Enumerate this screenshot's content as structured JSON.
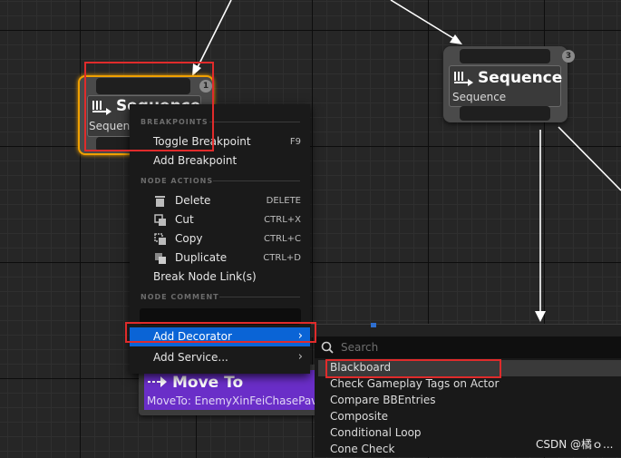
{
  "graph": {
    "node_left": {
      "title": "Sequence",
      "subtitle": "Sequence",
      "badge": "1",
      "icon": "sequence-icon"
    },
    "node_right": {
      "title": "Sequence",
      "subtitle": "Sequence",
      "badge": "3",
      "icon": "sequence-icon"
    },
    "node_moveto": {
      "title": "Move To",
      "subtitle": "MoveTo: EnemyXinFeiChasePav",
      "icon": "move-to-icon"
    }
  },
  "context_menu": {
    "sections": {
      "breakpoints": "BREAKPOINTS",
      "node_actions": "NODE ACTIONS",
      "node_comment": "NODE COMMENT"
    },
    "breakpoint_items": [
      {
        "label": "Toggle Breakpoint",
        "shortcut": "F9"
      },
      {
        "label": "Add Breakpoint",
        "shortcut": ""
      }
    ],
    "action_items": [
      {
        "label": "Delete",
        "shortcut": "DELETE",
        "icon": "trash-icon"
      },
      {
        "label": "Cut",
        "shortcut": "CTRL+X",
        "icon": "cut-icon"
      },
      {
        "label": "Copy",
        "shortcut": "CTRL+C",
        "icon": "copy-icon"
      },
      {
        "label": "Duplicate",
        "shortcut": "CTRL+D",
        "icon": "duplicate-icon"
      },
      {
        "label": "Break Node Link(s)",
        "shortcut": ""
      }
    ],
    "submenu_items": [
      {
        "label": "Add Decorator",
        "arrow": "›"
      },
      {
        "label": "Add Service...",
        "arrow": "›"
      }
    ]
  },
  "decorator_search": {
    "placeholder": "Search",
    "items": [
      "Blackboard",
      "Check Gameplay Tags on Actor",
      "Compare BBEntries",
      "Composite",
      "Conditional Loop",
      "Cone Check"
    ]
  },
  "colors": {
    "accent_blue": "#0a64d6",
    "highlight_red": "#e02b2b",
    "selection_orange": "#f0a000",
    "moveto_purple": "#6a2ec8"
  },
  "watermark": "CSDN @橘ｏ..."
}
